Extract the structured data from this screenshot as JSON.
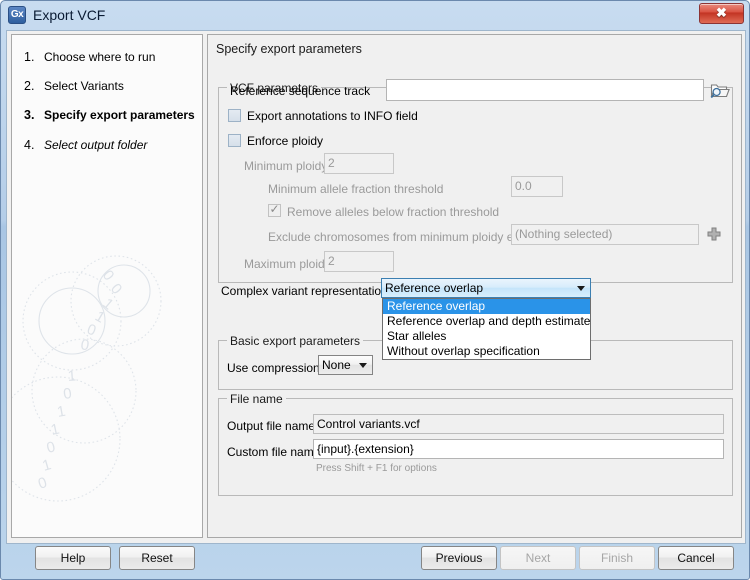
{
  "window": {
    "app_icon_text": "Gx",
    "title": "Export VCF",
    "close_label": "✕"
  },
  "sidebar": {
    "steps": [
      {
        "num": "1.",
        "label": "Choose where to run",
        "state": "done"
      },
      {
        "num": "2.",
        "label": "Select Variants",
        "state": "done"
      },
      {
        "num": "3.",
        "label": "Specify export parameters",
        "state": "current"
      },
      {
        "num": "4.",
        "label": "Select output folder",
        "state": "future"
      }
    ]
  },
  "main": {
    "heading": "Specify export parameters",
    "vcf_group": {
      "title": "VCF parameters",
      "reference_sequence_track": {
        "label": "Reference sequence track",
        "value": "",
        "browse_icon": "folder-search-icon"
      },
      "export_annotations": {
        "label": "Export annotations to INFO field",
        "checked": false
      },
      "enforce_ploidy": {
        "label": "Enforce ploidy",
        "checked": false
      },
      "minimum_ploidy": {
        "label": "Minimum ploidy",
        "value": "2",
        "enabled": false
      },
      "minimum_allele_fraction_threshold": {
        "label": "Minimum allele fraction threshold",
        "value": "0.0",
        "enabled": false
      },
      "remove_alleles": {
        "label": "Remove alleles below fraction threshold",
        "checked": true,
        "enabled": false
      },
      "exclude_chromosomes": {
        "label": "Exclude chromosomes from minimum ploidy export",
        "value": "(Nothing selected)",
        "enabled": false,
        "add_icon": "plus-icon"
      },
      "maximum_ploidy": {
        "label": "Maximum ploidy",
        "value": "2",
        "enabled": false
      },
      "complex_variant_representation": {
        "label": "Complex variant representation",
        "value": "Reference overlap",
        "expanded": true,
        "options": [
          "Reference overlap",
          "Reference overlap and depth estimate",
          "Star alleles",
          "Without overlap specification"
        ],
        "selected_index": 0
      }
    },
    "basic_group": {
      "title": "Basic export parameters",
      "use_compression": {
        "label": "Use compression",
        "value": "None"
      }
    },
    "filename_group": {
      "title": "File name",
      "output_file_name": {
        "label": "Output file name",
        "value": "Control variants.vcf"
      },
      "custom_file_name": {
        "label": "Custom file name",
        "value": "{input}.{extension}",
        "hint": "Press Shift + F1 for options"
      }
    }
  },
  "buttons": {
    "help": {
      "label": "Help",
      "enabled": true
    },
    "reset": {
      "label": "Reset",
      "enabled": true
    },
    "previous": {
      "label": "Previous",
      "enabled": true
    },
    "next": {
      "label": "Next",
      "enabled": false
    },
    "finish": {
      "label": "Finish",
      "enabled": false
    },
    "cancel": {
      "label": "Cancel",
      "enabled": true
    }
  },
  "colors": {
    "titlebar": "#aac6e3",
    "accent_selection": "#2a93e8",
    "close_button": "#c23322",
    "panel_bg": "#f0f0f0",
    "disabled_text": "#9a9a9a"
  }
}
